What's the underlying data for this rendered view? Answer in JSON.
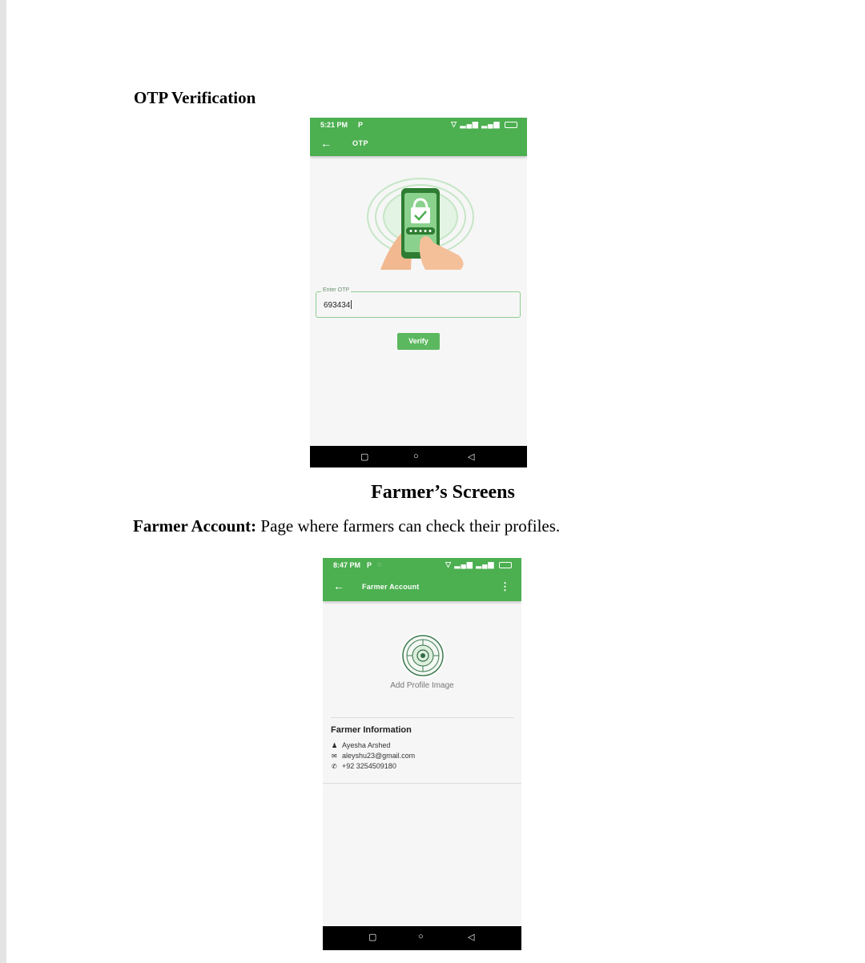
{
  "document": {
    "otp_heading": "OTP Verification",
    "farmer_screens_heading": "Farmer’s Screens",
    "farmer_account_label": "Farmer Account:",
    "farmer_account_desc": " Page where farmers can check their profiles."
  },
  "otp_screen": {
    "status_time": "5:21 PM",
    "status_app_icon": "P",
    "appbar_title": "OTP",
    "field_label": "Enter OTP",
    "field_value": "693434",
    "verify_label": "Verify",
    "colors": {
      "primary": "#4caf50",
      "button": "#5cb85f",
      "field_border": "#8fcf91"
    }
  },
  "farmer_screen": {
    "status_time": "8:47 PM",
    "status_app_icon": "P",
    "appbar_title": "Farmer Account",
    "add_profile_label": "Add Profile Image",
    "info_title": "Farmer Information",
    "name": "Ayesha Arshed",
    "email": "aleyshu23@gmail.com",
    "phone": "+92 3254509180",
    "colors": {
      "primary": "#4caf50"
    }
  },
  "icons": [
    "back-arrow-icon",
    "menu-dots-icon",
    "wifi-icon",
    "signal-icon",
    "battery-icon",
    "person-icon",
    "mail-icon",
    "phone-icon",
    "nav-recent-icon",
    "nav-home-icon",
    "nav-back-icon"
  ]
}
